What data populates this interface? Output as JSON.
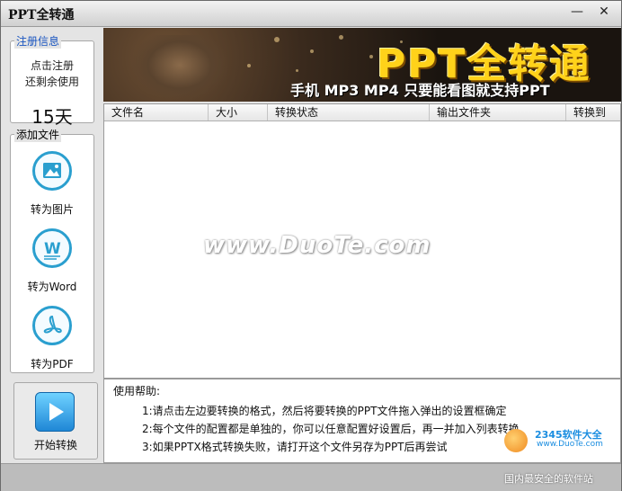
{
  "window": {
    "title": "PPT全转通",
    "minimize_glyph": "—",
    "close_glyph": "✕"
  },
  "sidebar": {
    "register": {
      "title": "注册信息",
      "line1": "点击注册",
      "line2": "还剩余使用",
      "days": "15天"
    },
    "add_files": {
      "title": "添加文件"
    },
    "tools": [
      {
        "label": "转为图片",
        "icon": "image-icon"
      },
      {
        "label": "转为Word",
        "icon": "word-icon"
      },
      {
        "label": "转为PDF",
        "icon": "pdf-icon"
      }
    ],
    "start": {
      "label": "开始转换",
      "icon": "play-icon"
    }
  },
  "banner": {
    "brand": "PPT全转通",
    "slogan": "手机 MP3 MP4 只要能看图就支持PPT"
  },
  "file_list": {
    "columns": [
      "文件名",
      "大小",
      "转换状态",
      "输出文件夹",
      "转换到"
    ],
    "rows": []
  },
  "watermark": "www.DuoTe.com",
  "help": {
    "title": "使用帮助:",
    "lines": [
      "1:请点击左边要转换的格式，然后将要转换的PPT文件拖入弹出的设置框确定",
      "2:每个文件的配置都是单独的，你可以任意配置好设置后，再一并加入列表转换",
      "3:如果PPTX格式转换失败，请打开这个文件另存为PPT后再尝试"
    ]
  },
  "corner_watermark": {
    "brand": "2345软件大全",
    "url": "www.DuoTe.com",
    "tagline": "国内最安全的软件站"
  },
  "colors": {
    "accent": "#2a9fcf",
    "brand_yellow": "#ffd21a",
    "link_blue": "#1a55c0"
  }
}
